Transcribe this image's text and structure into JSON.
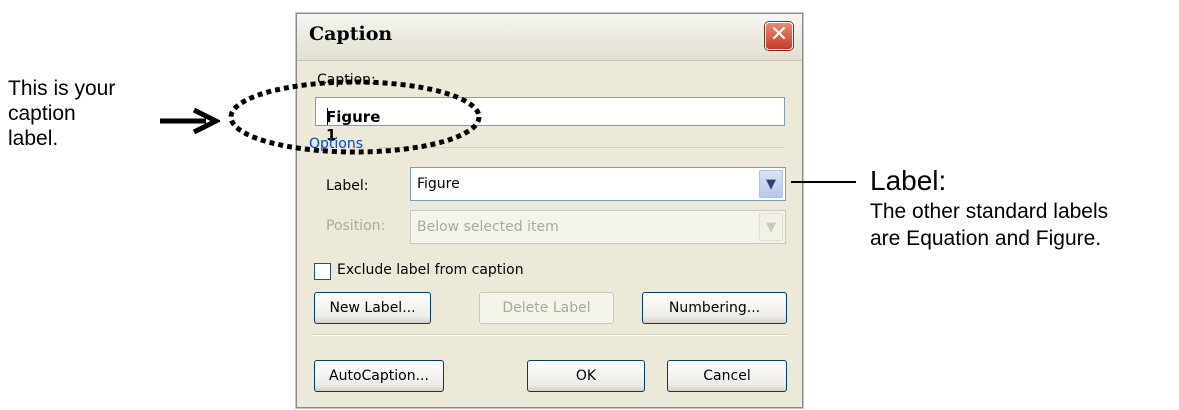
{
  "annotation_left": {
    "lines": [
      "This is your",
      "caption",
      "label."
    ]
  },
  "annotation_right": {
    "title": "Label:",
    "body_lines": [
      "The other standard labels",
      "are Equation and Figure."
    ]
  },
  "dialog": {
    "title": "Caption",
    "caption_label": "Caption:",
    "caption_value": "Figure 1",
    "options_group": "Options",
    "label_label": "Label:",
    "label_value": "Figure",
    "position_label": "Position:",
    "position_value": "Below selected item",
    "exclude_checkbox_label": "Exclude label from caption",
    "exclude_checked": false,
    "buttons": {
      "new_label": "New Label...",
      "delete_label": "Delete Label",
      "numbering": "Numbering...",
      "autocaption": "AutoCaption...",
      "ok": "OK",
      "cancel": "Cancel"
    }
  },
  "colors": {
    "dialog_bg": "#ece9d8",
    "close_button": "#c6392a",
    "group_label": "#0046d5"
  }
}
